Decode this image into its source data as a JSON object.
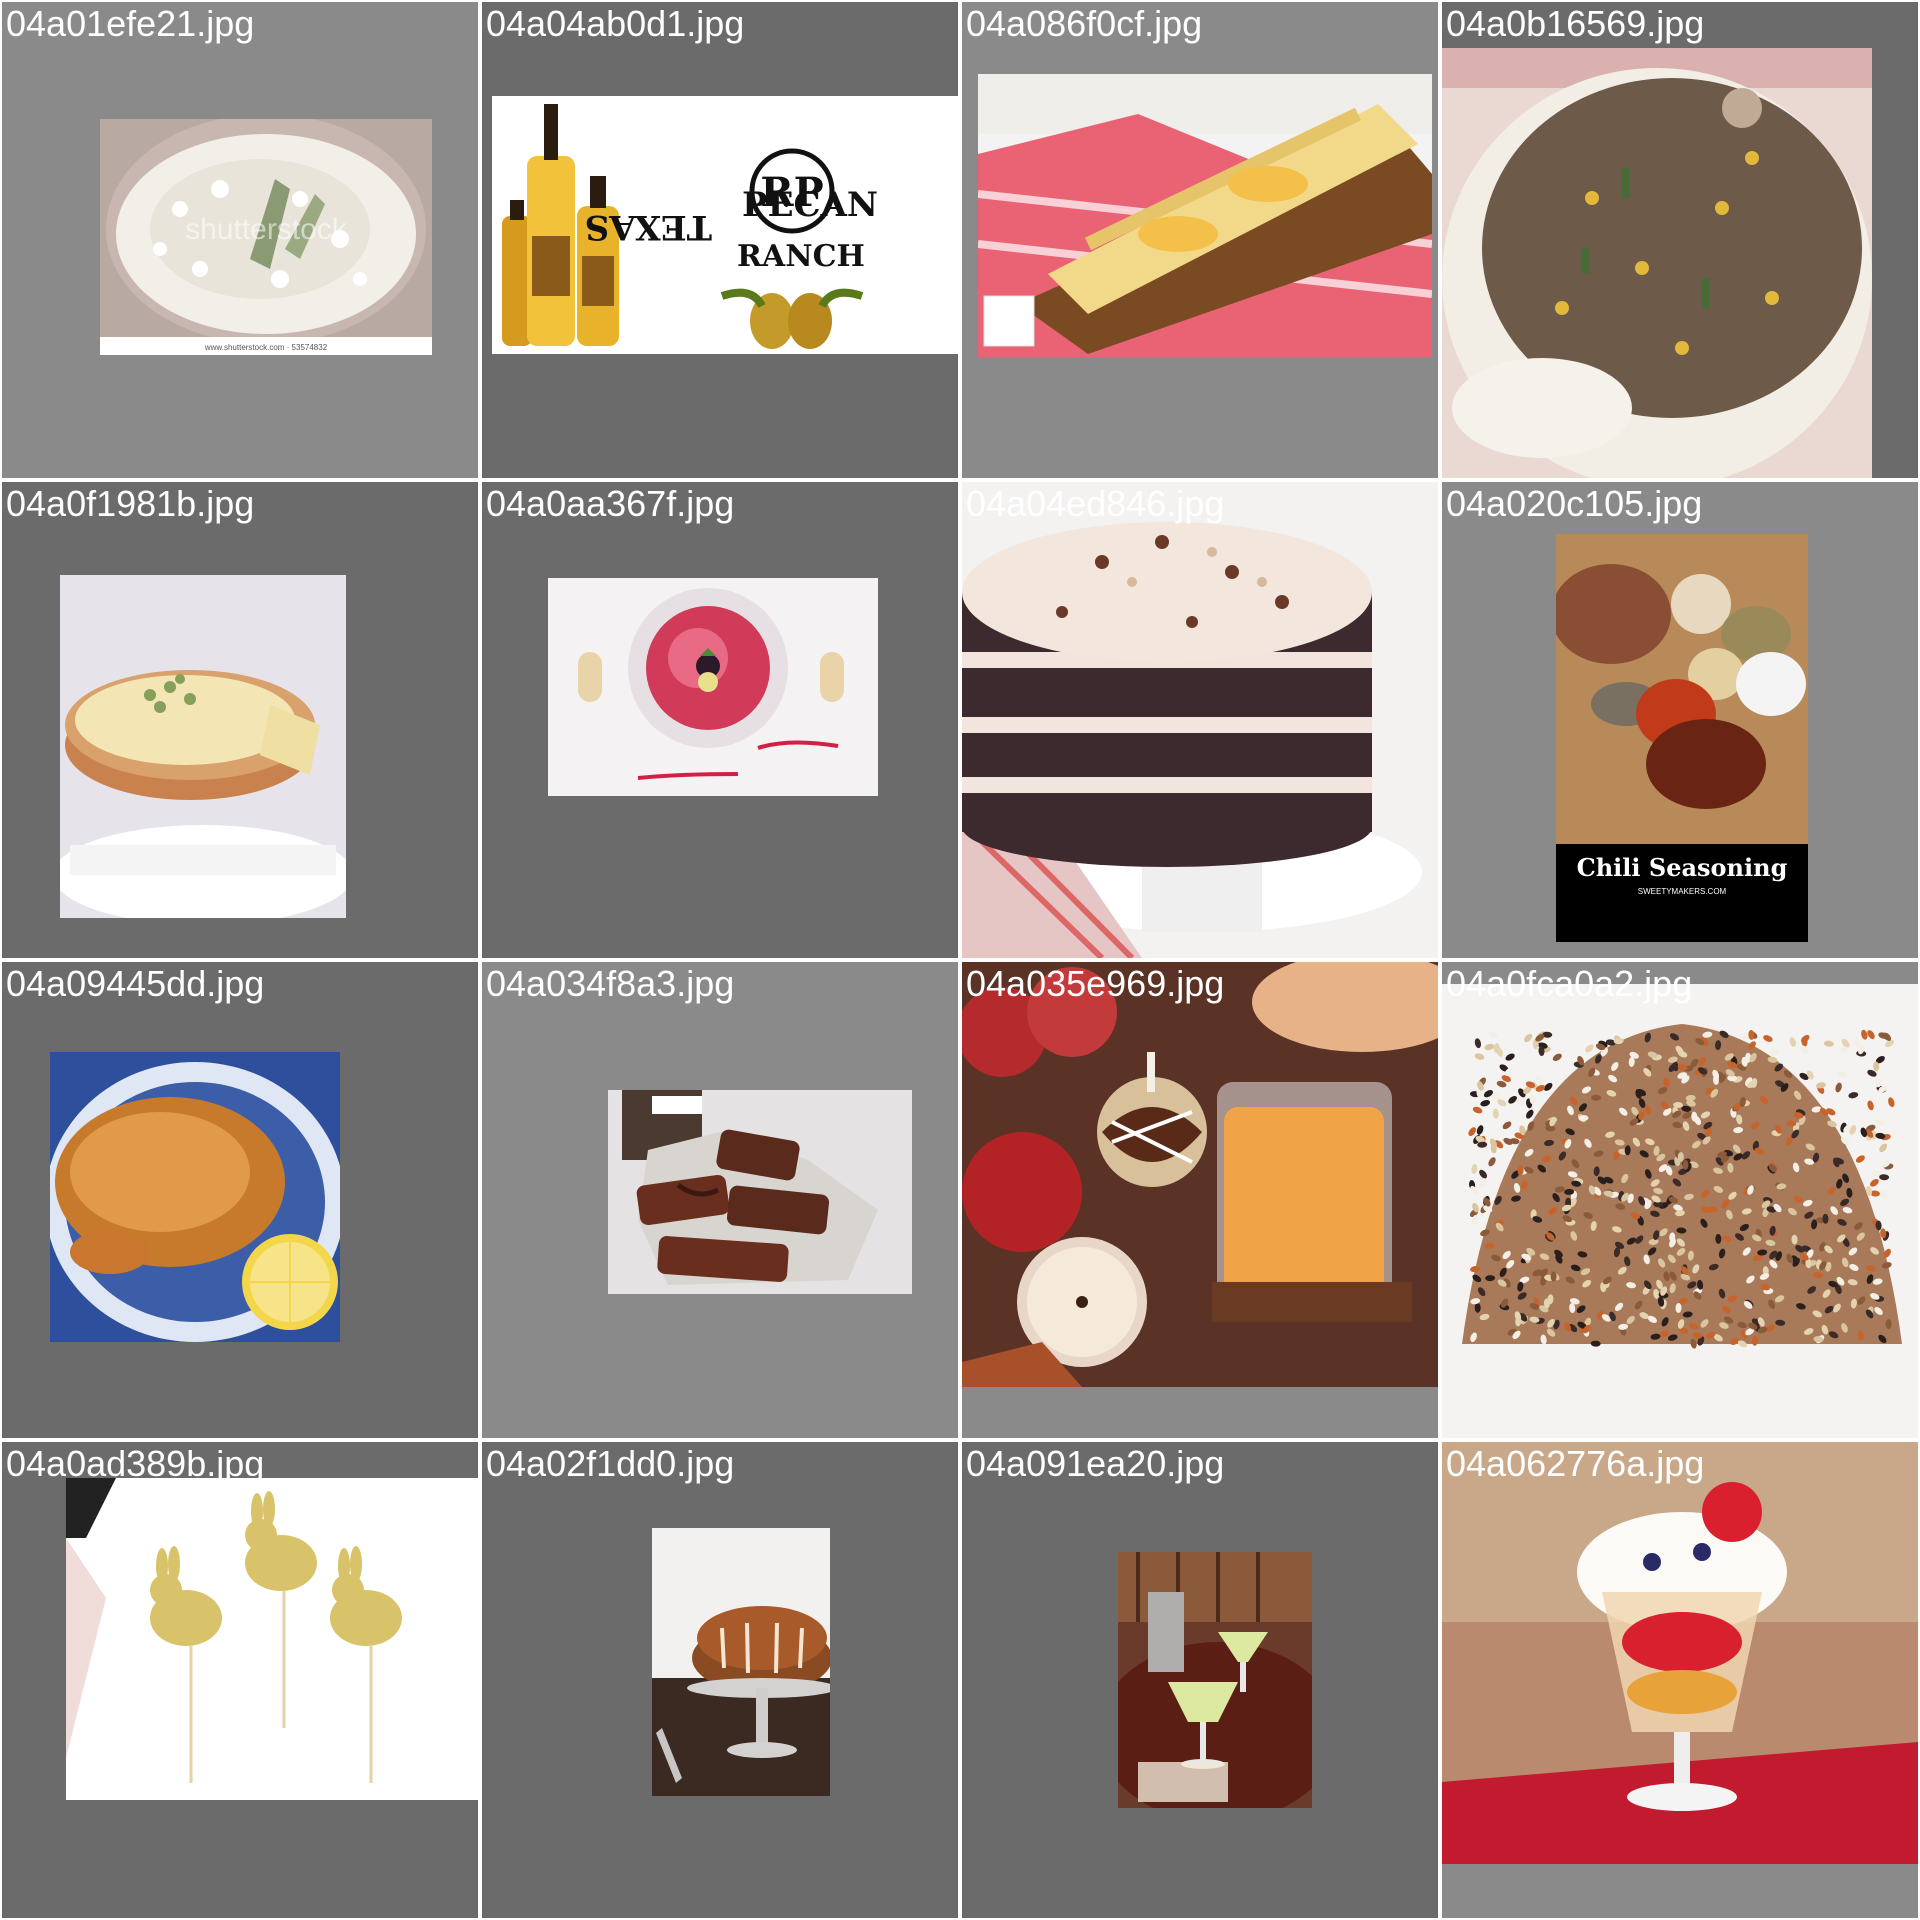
{
  "tiles": [
    {
      "filename": "04a01efe21.jpg",
      "bg": "#8a8a8a",
      "image": "risotto-with-herbs",
      "watermark": "shutterstock",
      "footer_text": "www.shutterstock.com · 53574832"
    },
    {
      "filename": "04a04ab0d1.jpg",
      "bg": "#6b6b6b",
      "image": "pecan-oil-bottles-with-logo",
      "logo_text": [
        "TEXAS",
        "PECAN",
        "RANCH"
      ]
    },
    {
      "filename": "04a086f0cf.jpg",
      "bg": "#8a8a8a",
      "image": "fruit-strudel-on-board"
    },
    {
      "filename": "04a0b16569.jpg",
      "bg": "#6b6b6b",
      "image": "ground-meat-corn-over-rice"
    },
    {
      "filename": "04a0f1981b.jpg",
      "bg": "#6b6b6b",
      "image": "lemon-tart-with-pistachios"
    },
    {
      "filename": "04a0aa367f.jpg",
      "bg": "#6b6b6b",
      "image": "raspberry-dessert-plate"
    },
    {
      "filename": "04a04ed846.jpg",
      "bg": "#8a8a8a",
      "image": "chocolate-layer-cake"
    },
    {
      "filename": "04a020c105.jpg",
      "bg": "#8a8a8a",
      "image": "chili-seasoning-spices",
      "caption": "Chili Seasoning",
      "caption_small": "SWEETYMAKERS.COM"
    },
    {
      "filename": "04a09445dd.jpg",
      "bg": "#6b6b6b",
      "image": "roast-chicken-with-lemon"
    },
    {
      "filename": "04a034f8a3.jpg",
      "bg": "#8a8a8a",
      "image": "chocolate-covered-bars"
    },
    {
      "filename": "04a035e969.jpg",
      "bg": "#8a8a8a",
      "image": "apple-cider-and-caramel-apples"
    },
    {
      "filename": "04a0fca0a2.jpg",
      "bg": "#8a8a8a",
      "image": "mixed-wild-rice"
    },
    {
      "filename": "04a0ad389b.jpg",
      "bg": "#6b6b6b",
      "image": "gold-bunny-cake-toppers"
    },
    {
      "filename": "04a02f1dd0.jpg",
      "bg": "#6b6b6b",
      "image": "bundt-cake-on-stand"
    },
    {
      "filename": "04a091ea20.jpg",
      "bg": "#6b6b6b",
      "image": "margaritas-on-table"
    },
    {
      "filename": "04a062776a.jpg",
      "bg": "#8a8a8a",
      "image": "fruit-cream-trifle-cup"
    }
  ]
}
